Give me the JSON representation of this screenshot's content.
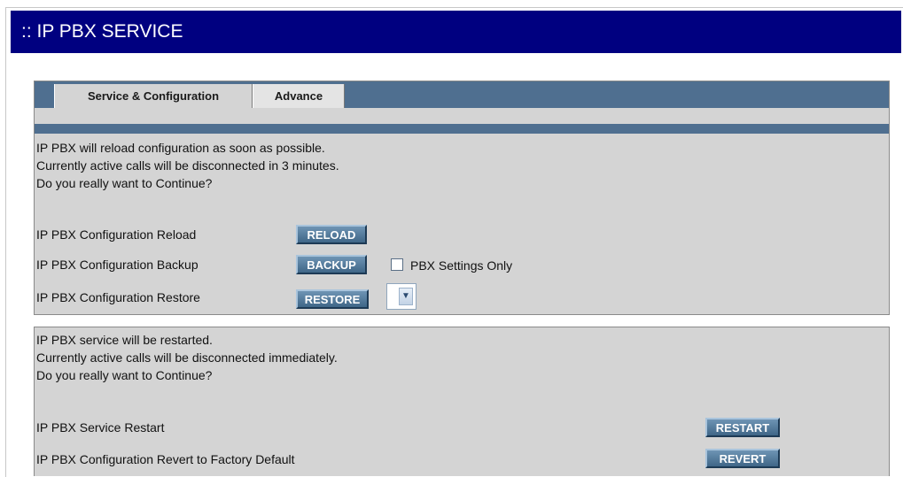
{
  "header": {
    "title": ":: IP PBX SERVICE"
  },
  "tabs": [
    {
      "label": "Service & Configuration",
      "active": true
    },
    {
      "label": "Advance",
      "active": false
    }
  ],
  "config_panel": {
    "warning_lines": [
      "IP PBX will reload configuration as soon as possible.",
      "Currently active calls will be disconnected in 3 minutes.",
      "Do you really want to Continue?"
    ],
    "reload": {
      "label": "IP PBX Configuration Reload",
      "button": "RELOAD"
    },
    "backup": {
      "label": "IP PBX Configuration Backup",
      "button": "BACKUP",
      "checkbox_label": "PBX Settings Only",
      "checked": false
    },
    "restore": {
      "label": "IP PBX Configuration Restore",
      "button": "RESTORE",
      "select_value": ""
    }
  },
  "service_panel": {
    "warning_lines": [
      "IP PBX service will be restarted.",
      "Currently active calls will be disconnected immediately.",
      "Do you really want to Continue?"
    ],
    "restart": {
      "label": "IP PBX Service Restart",
      "button": "RESTART"
    },
    "revert": {
      "label": "IP PBX Configuration Revert to Factory Default",
      "button": "REVERT"
    }
  },
  "colors": {
    "title_bar": "#000080",
    "tab_strip": "#4f6f90",
    "panel_bg": "#d4d4d4",
    "button": "#4a7090"
  }
}
